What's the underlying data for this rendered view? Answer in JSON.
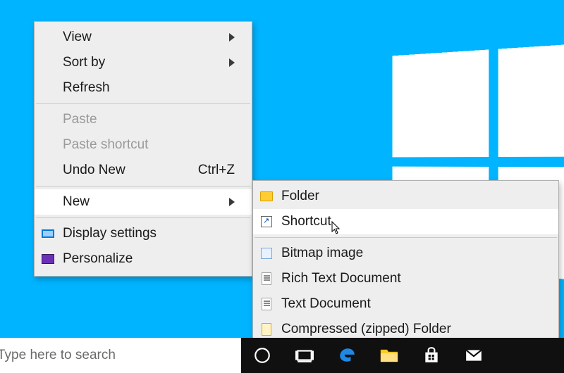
{
  "desktop": {
    "context_menu": {
      "items": [
        {
          "label": "View",
          "submenu": true
        },
        {
          "label": "Sort by",
          "submenu": true
        },
        {
          "label": "Refresh"
        }
      ],
      "clipboard": [
        {
          "label": "Paste",
          "disabled": true
        },
        {
          "label": "Paste shortcut",
          "disabled": true
        },
        {
          "label": "Undo New",
          "accelerator": "Ctrl+Z"
        }
      ],
      "new": {
        "label": "New",
        "submenu": true,
        "hovered": true
      },
      "settings": [
        {
          "label": "Display settings",
          "icon": "display-icon"
        },
        {
          "label": "Personalize",
          "icon": "personalize-icon"
        }
      ]
    },
    "new_submenu": {
      "items_top": [
        {
          "label": "Folder",
          "icon": "folder-icon"
        },
        {
          "label": "Shortcut",
          "icon": "shortcut-icon",
          "hovered": true
        }
      ],
      "items_bottom": [
        {
          "label": "Bitmap image",
          "icon": "bitmap-icon"
        },
        {
          "label": "Rich Text Document",
          "icon": "rtf-icon"
        },
        {
          "label": "Text Document",
          "icon": "txt-icon"
        },
        {
          "label": "Compressed (zipped) Folder",
          "icon": "zip-icon"
        }
      ]
    }
  },
  "taskbar": {
    "search_placeholder": "Type here to search"
  }
}
